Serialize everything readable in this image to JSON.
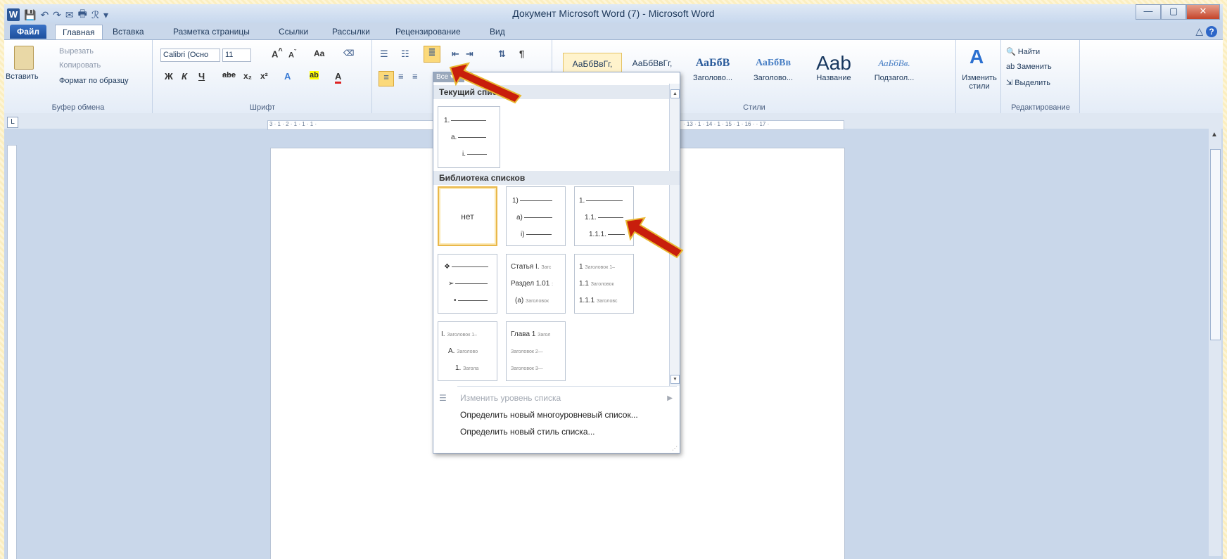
{
  "window": {
    "title": "Документ Microsoft Word (7)  -  Microsoft Word"
  },
  "qat": [
    "↶",
    "↷",
    "✉",
    "🖶",
    "ℛ"
  ],
  "tabs": [
    {
      "label": "Файл"
    },
    {
      "label": "Главная"
    },
    {
      "label": "Вставка"
    },
    {
      "label": "Разметка страницы"
    },
    {
      "label": "Ссылки"
    },
    {
      "label": "Рассылки"
    },
    {
      "label": "Рецензирование"
    },
    {
      "label": "Вид"
    }
  ],
  "clipboard": {
    "paste": "Вставить",
    "cut": "Вырезать",
    "copy": "Копировать",
    "format_painter": "Формат по образцу",
    "label": "Буфер обмена"
  },
  "font": {
    "name": "Calibri (Осно",
    "size": "11",
    "label": "Шрифт",
    "bold": "Ж",
    "italic": "К",
    "underline": "Ч",
    "strike": "abe",
    "sub": "x₂",
    "sup": "x²"
  },
  "styles": {
    "label": "Стили",
    "items": [
      {
        "preview": "АаБбВвГг,",
        "name": ""
      },
      {
        "preview": "АаБбВвГг,",
        "name": ""
      },
      {
        "preview": "АаБбВ",
        "name": "Заголово..."
      },
      {
        "preview": "АаБбВв",
        "name": "Заголово..."
      },
      {
        "preview": "Aab",
        "name": "Название"
      },
      {
        "preview": "АаБбВв.",
        "name": "Подзагол..."
      }
    ],
    "change": "Изменить стили"
  },
  "editing": {
    "find": "Найти",
    "replace": "Заменить",
    "select": "Выделить",
    "label": "Редактирование"
  },
  "dropdown": {
    "filter": "Все",
    "current_section": "Текущий список",
    "current_list": [
      "1.",
      "a.",
      "i."
    ],
    "library_section": "Библиотека списков",
    "none_label": "нет",
    "list_a": [
      "1)",
      "a)",
      "i)"
    ],
    "list_b": [
      "1.",
      "1.1.",
      "1.1.1."
    ],
    "list_c": [
      "❖",
      "➢",
      "•"
    ],
    "list_d": [
      {
        "main": "Статья I.",
        "small": "Загс"
      },
      {
        "main": "Раздел 1.01",
        "small": ":"
      },
      {
        "main": "(a)",
        "small": "Заголовок"
      }
    ],
    "list_e": [
      {
        "main": "1",
        "small": "Заголовок 1–"
      },
      {
        "main": "1.1",
        "small": "Заголовок"
      },
      {
        "main": "1.1.1",
        "small": "Заголовс"
      }
    ],
    "list_f": [
      {
        "main": "I.",
        "small": "Заголовок 1–"
      },
      {
        "main": "A.",
        "small": "Заголово"
      },
      {
        "main": "1.",
        "small": "Загола"
      }
    ],
    "list_g": [
      {
        "main": "Глава 1",
        "small": "Загол"
      },
      {
        "main": "",
        "small": "Заголовок 2—"
      },
      {
        "main": "",
        "small": "Заголовок 3—"
      }
    ],
    "change_level": "Изменить уровень списка",
    "define_multilevel": "Определить новый многоуровневый список...",
    "define_style": "Определить новый стиль списка..."
  },
  "ruler": {
    "numbers_left": "3 · 1 · 2 · 1 · 1 · 1 ·",
    "numbers_right": "· 13 · 1 · 14 · 1 · 15 · 1 · 16 ·  · 17 ·"
  },
  "colors": {
    "arrow": "#c81e0c",
    "arrow_outline": "#e8b730"
  }
}
